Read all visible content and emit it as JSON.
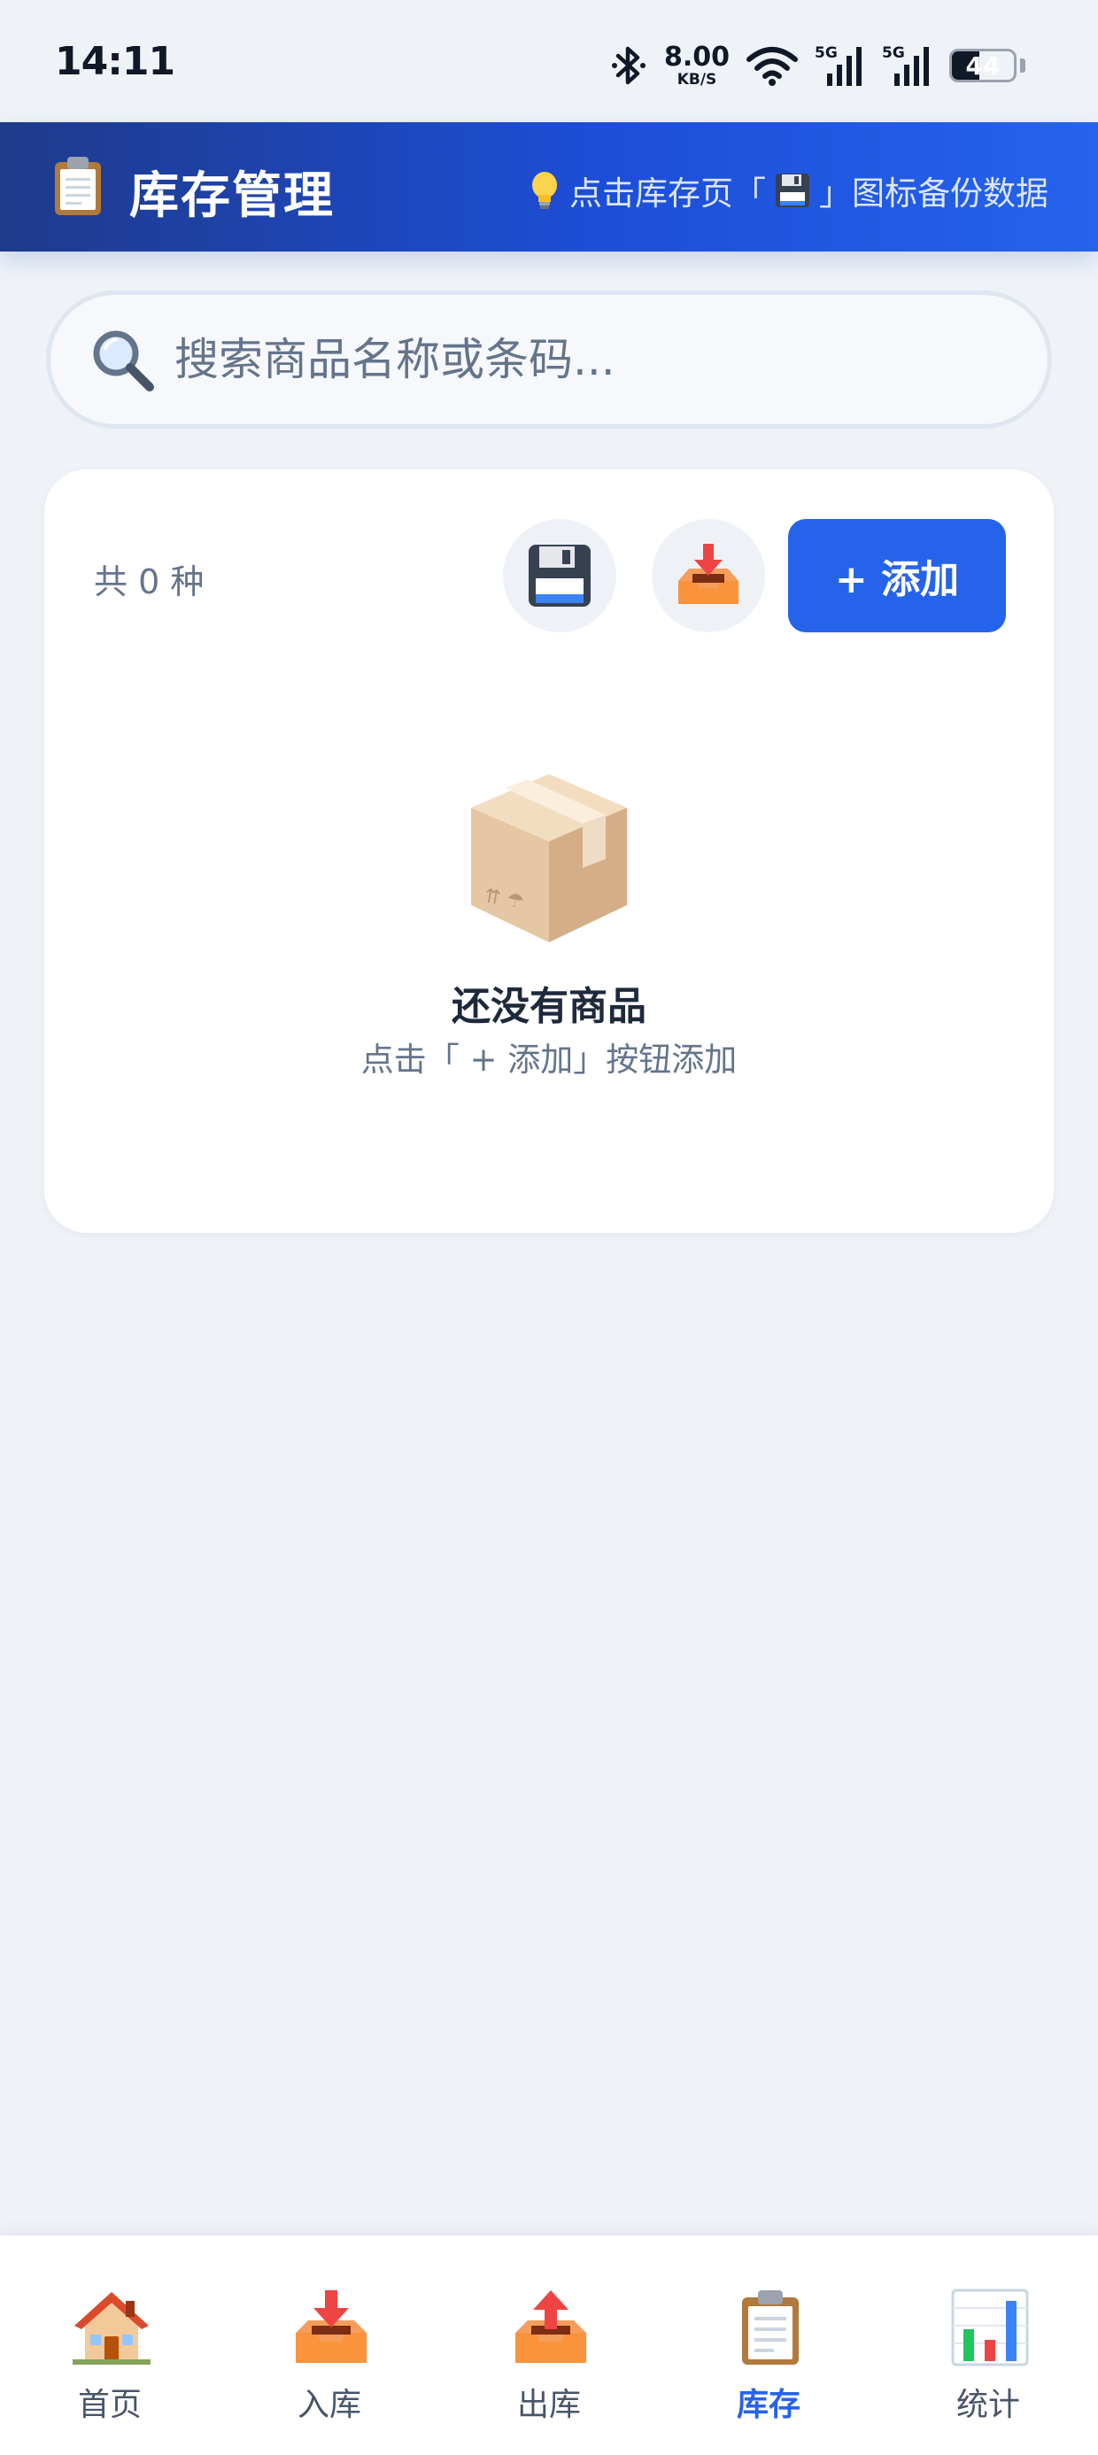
{
  "status_bar": {
    "time": "14:11",
    "net_speed_value": "8.00",
    "net_speed_unit": "KB/S",
    "signal_1_label": "5G",
    "signal_2_label": "5G",
    "battery_level": "44",
    "battery_fraction": 0.44,
    "icons": [
      "bluetooth-icon",
      "wifi-icon",
      "signal-icon",
      "signal-icon",
      "battery-icon"
    ]
  },
  "header": {
    "title": "库存管理",
    "icon": "clipboard-icon",
    "hint_prefix": "点击库存页「",
    "hint_icon": "floppy-disk-icon",
    "hint_suffix": "」图标备份数据",
    "hint_lead_icon": "lightbulb-icon"
  },
  "search": {
    "placeholder": "搜索商品名称或条码...",
    "value": "",
    "icon": "magnifier-icon"
  },
  "inventory": {
    "count_label": "共 0 种",
    "backup_icon": "floppy-disk-icon",
    "import_icon": "inbox-tray-icon",
    "add_label": "+ 添加",
    "empty_icon": "package-box-icon",
    "empty_title": "还没有商品",
    "empty_subtitle": "点击「 + 添加」按钮添加"
  },
  "nav": {
    "items": [
      {
        "label": "首页",
        "icon": "house-icon"
      },
      {
        "label": "入库",
        "icon": "inbox-tray-icon"
      },
      {
        "label": "出库",
        "icon": "outbox-tray-icon"
      },
      {
        "label": "库存",
        "icon": "clipboard-icon",
        "active": true
      },
      {
        "label": "统计",
        "icon": "bar-chart-icon"
      }
    ]
  },
  "colors": {
    "accent": "#2563eb",
    "header_start": "#1e3a8a",
    "header_end": "#2563eb",
    "background": "#eff3f8",
    "card": "#ffffff",
    "muted_text": "#64748b"
  }
}
